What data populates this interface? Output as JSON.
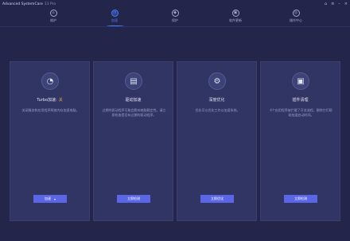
{
  "window": {
    "title": "Advanced SystemCare",
    "version": "13 Pro",
    "controls": [
      "⌂",
      "≡",
      "–",
      "×"
    ]
  },
  "nav": {
    "items": [
      {
        "label": "维护",
        "icon": "home-icon"
      },
      {
        "label": "加速",
        "icon": "speed-icon"
      },
      {
        "label": "保护",
        "icon": "shield-icon"
      },
      {
        "label": "软件更新",
        "icon": "update-icon"
      },
      {
        "label": "操作中心",
        "icon": "action-center-icon"
      }
    ],
    "active_index": 1
  },
  "cards": [
    {
      "title": "Turbo加速:",
      "status": "关",
      "desc": "关闭服务和应用程序释放内存加速电脑。",
      "button": "加速",
      "button_arrow": "▾",
      "icon": "turbo-gauge-icon"
    },
    {
      "title": "驱动加速",
      "desc": "过期的驱动程序可能会影响电脑稳定性。请立即检查是否有过期的驱动程序。",
      "button": "立即检测",
      "icon": "driver-icon"
    },
    {
      "title": "深度优化",
      "desc": "优化可以优化工作以加速系统。",
      "button": "立即优化",
      "icon": "gear-icon"
    },
    {
      "title": "插件清理",
      "desc": "4个启用程序被拦截了开关流程，删除它们帮助加速启动时间。",
      "button": "立即检测",
      "icon": "plugin-icon"
    }
  ],
  "colors": {
    "background": "#23264a",
    "card": "#313563",
    "accent": "#4c7cf5",
    "button": "#5b66e6",
    "status_off": "#f0a340"
  }
}
